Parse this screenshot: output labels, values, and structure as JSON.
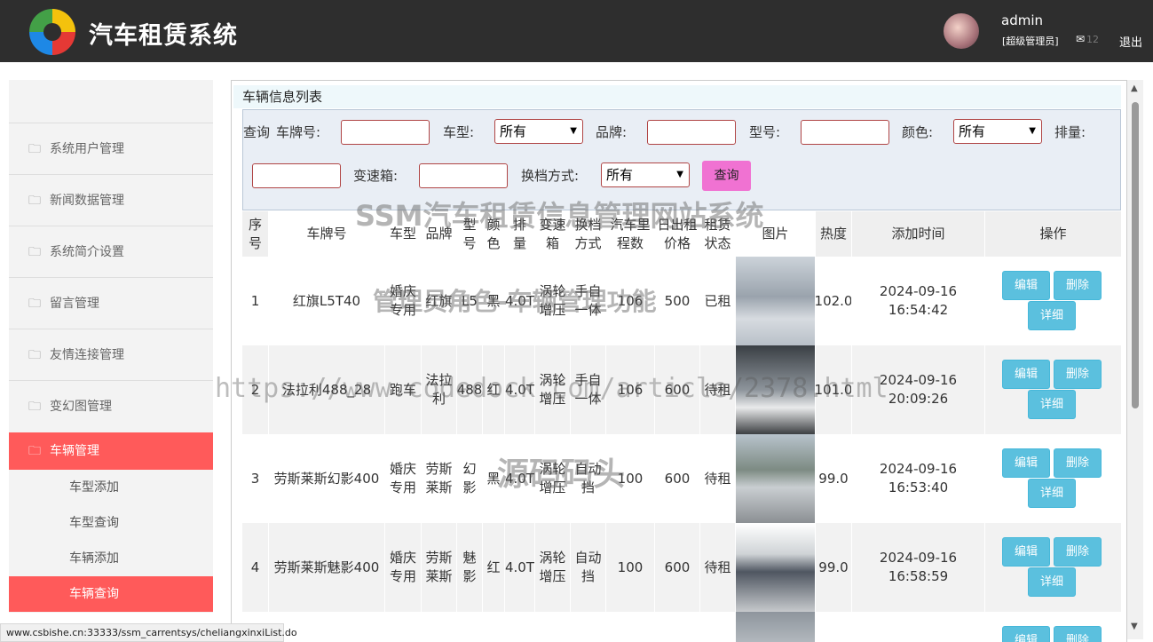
{
  "header": {
    "title": "汽车租赁系统",
    "username": "admin",
    "role": "[超级管理员]",
    "mail_count": "12",
    "logout": "退出"
  },
  "sidebar": {
    "items": [
      "系统用户管理",
      "新闻数据管理",
      "系统简介设置",
      "留言管理",
      "友情连接管理",
      "变幻图管理",
      "车辆管理"
    ],
    "subitems": [
      "车型添加",
      "车型查询",
      "车辆添加",
      "车辆查询"
    ]
  },
  "page_title": "车辆信息列表",
  "search": {
    "query": "查询",
    "plate": "车牌号:",
    "cartype": "车型:",
    "cartype_val": "所有",
    "brand": "品牌:",
    "model": "型号:",
    "color": "颜色:",
    "color_val": "所有",
    "displacement": "排量:",
    "gearbox": "变速箱:",
    "shift": "换档方式:",
    "shift_val": "所有",
    "button": "查询"
  },
  "table": {
    "headers": [
      "序号",
      "车牌号",
      "车型",
      "品牌",
      "型号",
      "颜色",
      "排量",
      "变速箱",
      "换档方式",
      "汽车里程数",
      "日出租价格",
      "租赁状态",
      "图片",
      "热度",
      "添加时间",
      "操作"
    ],
    "rows": [
      [
        "1",
        "红旗L5T40",
        "婚庆专用",
        "红旗",
        "L5",
        "黑",
        "4.0T",
        "涡轮增压",
        "手自一体",
        "106",
        "500",
        "已租",
        "",
        "102.0",
        "2024-09-16 16:54:42"
      ],
      [
        "2",
        "法拉利488_28",
        "跑车",
        "法拉利",
        "488",
        "红",
        "4.0T",
        "涡轮增压",
        "手自一体",
        "106",
        "600",
        "待租",
        "",
        "101.0",
        "2024-09-16 20:09:26"
      ],
      [
        "3",
        "劳斯莱斯幻影400",
        "婚庆专用",
        "劳斯莱斯",
        "幻影",
        "黑",
        "4.0T",
        "涡轮增压",
        "自动挡",
        "100",
        "600",
        "待租",
        "",
        "99.0",
        "2024-09-16 16:53:40"
      ],
      [
        "4",
        "劳斯莱斯魅影400",
        "婚庆专用",
        "劳斯莱斯",
        "魅影",
        "红",
        "4.0T",
        "涡轮增压",
        "自动挡",
        "100",
        "600",
        "待租",
        "",
        "99.0",
        "2024-09-16 16:58:59"
      ],
      [
        "",
        "",
        "",
        "",
        "",
        "",
        "",
        "",
        "",
        "",
        "",
        "",
        "",
        "",
        ""
      ]
    ],
    "btn_edit": "编辑",
    "btn_delete": "删除",
    "btn_detail": "详细"
  },
  "watermarks": [
    "SSM汽车租赁信息管理网站系统",
    "管理员角色-车辆管理功能",
    "https://www.codedock.com/article/2378.html",
    "源码码头"
  ],
  "status_url": "www.csbishe.cn:33333/ssm_carrentsys/cheliangxinxiList.do"
}
